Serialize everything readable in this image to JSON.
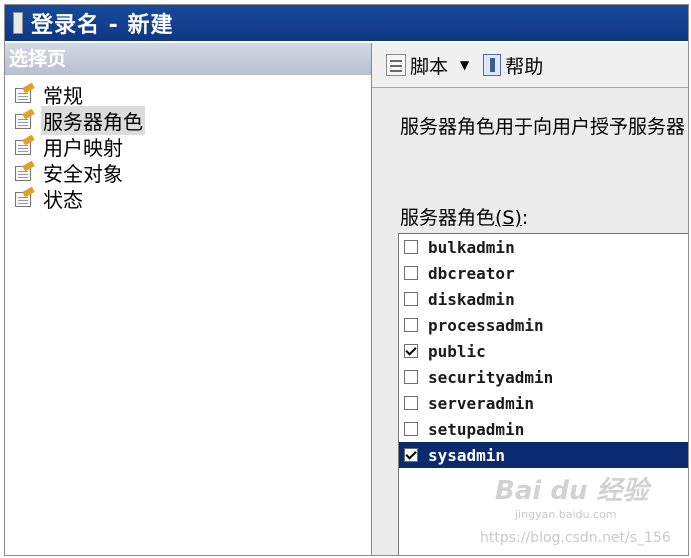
{
  "window": {
    "title": "登录名 - 新建"
  },
  "left_panel": {
    "header": "选择页",
    "items": [
      {
        "label": "常规",
        "selected": false
      },
      {
        "label": "服务器角色",
        "selected": true
      },
      {
        "label": "用户映射",
        "selected": false
      },
      {
        "label": "安全对象",
        "selected": false
      },
      {
        "label": "状态",
        "selected": false
      }
    ]
  },
  "toolbar": {
    "script_label": "脚本",
    "dropdown_arrow": "▼",
    "help_label": "帮助"
  },
  "main": {
    "description": "服务器角色用于向用户授予服务器",
    "roles_label": "服务器角色",
    "roles_label_key": "(S)",
    "roles_label_suffix": ":",
    "roles": [
      {
        "name": "bulkadmin",
        "checked": false,
        "selected": false
      },
      {
        "name": "dbcreator",
        "checked": false,
        "selected": false
      },
      {
        "name": "diskadmin",
        "checked": false,
        "selected": false
      },
      {
        "name": "processadmin",
        "checked": false,
        "selected": false
      },
      {
        "name": "public",
        "checked": true,
        "selected": false
      },
      {
        "name": "securityadmin",
        "checked": false,
        "selected": false
      },
      {
        "name": "serveradmin",
        "checked": false,
        "selected": false
      },
      {
        "name": "setupadmin",
        "checked": false,
        "selected": false
      },
      {
        "name": "sysadmin",
        "checked": true,
        "selected": true
      }
    ]
  },
  "watermark": {
    "logo": "Bai du 经验",
    "url": "jingyan.baidu.com",
    "credit": "https://blog.csdn.net/s_156"
  },
  "colors": {
    "titlebar": "#174a9a",
    "selection": "#0b2a6f",
    "panel_background": "#ececec"
  }
}
